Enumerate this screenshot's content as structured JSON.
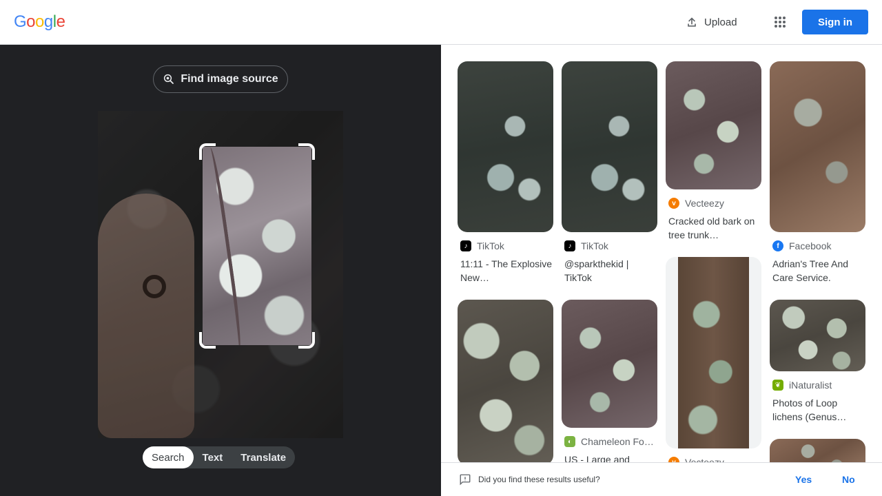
{
  "header": {
    "logo": [
      "G",
      "o",
      "o",
      "g",
      "l",
      "e"
    ],
    "logo_colors": [
      "#4285f4",
      "#ea4335",
      "#fbbc05",
      "#4285f4",
      "#34a853",
      "#ea4335"
    ],
    "upload_label": "Upload",
    "signin_label": "Sign in"
  },
  "lens": {
    "find_source_label": "Find image source",
    "modes": [
      "Search",
      "Text",
      "Translate"
    ],
    "active_mode": "Search"
  },
  "results": [
    {
      "source": "TikTok",
      "title": "11:11 - The Explosive New…",
      "icon": "tiktok-icon",
      "icon_color": "#000000"
    },
    {
      "source": "TikTok",
      "title": "@sparkthekid | TikTok",
      "icon": "tiktok-icon",
      "icon_color": "#000000"
    },
    {
      "source": "Vecteezy",
      "title": "Cracked old bark on tree trunk…",
      "icon": "vecteezy-icon",
      "icon_color": "#f57c00"
    },
    {
      "source": "Facebook",
      "title": "Adrian's Tree And Care Service.",
      "icon": "facebook-icon",
      "icon_color": "#1877f2"
    },
    {
      "source": "",
      "title": "",
      "icon": "",
      "icon_color": ""
    },
    {
      "source": "Chameleon Fo…",
      "title": "US - Large and",
      "icon": "chameleon-icon",
      "icon_color": "#7cb342"
    },
    {
      "source": "Vecteezy",
      "title": "",
      "icon": "vecteezy-icon",
      "icon_color": "#f57c00"
    },
    {
      "source": "iNaturalist",
      "title": "Photos of Loop lichens (Genus…",
      "icon": "inaturalist-icon",
      "icon_color": "#74ac00"
    }
  ],
  "feedback": {
    "question": "Did you find these results useful?",
    "yes_label": "Yes",
    "no_label": "No"
  }
}
